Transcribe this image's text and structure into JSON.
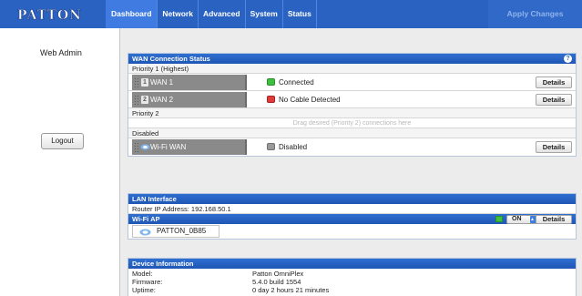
{
  "brand": {
    "logo_text": "PATTON"
  },
  "nav": {
    "tabs": [
      {
        "label": "Dashboard",
        "active": true
      },
      {
        "label": "Network"
      },
      {
        "label": "Advanced"
      },
      {
        "label": "System"
      },
      {
        "label": "Status"
      }
    ],
    "apply_label": "Apply Changes"
  },
  "sidebar": {
    "title": "Web Admin",
    "logout_label": "Logout"
  },
  "wan": {
    "title": "WAN Connection Status",
    "help": "?",
    "priority1_label": "Priority 1 (Highest)",
    "priority2_label": "Priority 2",
    "disabled_label": "Disabled",
    "drop_hint": "Drag desired (Priority 2) connections here",
    "connections": [
      {
        "num": "1",
        "name": "WAN 1",
        "status": "Connected",
        "status_color": "#3fbf3f",
        "details": "Details"
      },
      {
        "num": "2",
        "name": "WAN 2",
        "status": "No Cable Detected",
        "status_color": "#e03a3a",
        "details": "Details"
      }
    ],
    "disabled_connection": {
      "name": "Wi-Fi WAN",
      "status": "Disabled",
      "status_color": "#9a9a9a",
      "details": "Details"
    }
  },
  "lan": {
    "title": "LAN Interface",
    "router_ip": "Router IP Address: 192.168.50.1"
  },
  "wifi_ap": {
    "title": "Wi-Fi AP",
    "ssid": "PATTON_0B85",
    "state": "ON",
    "details": "Details"
  },
  "device": {
    "title": "Device Information",
    "rows": [
      {
        "key": "Model:",
        "value": "Patton OmniPlex"
      },
      {
        "key": "Firmware:",
        "value": "5.4.0 build 1554"
      },
      {
        "key": "Uptime:",
        "value": "0 day 2 hours 21 minutes"
      }
    ]
  },
  "colors": {
    "nav_bg": "#2a62c2",
    "panel_header": "#2f6fd0",
    "page_bg": "#ececec"
  }
}
